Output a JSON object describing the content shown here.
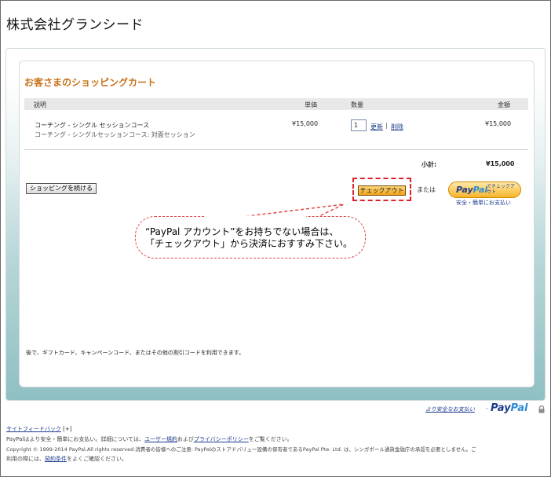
{
  "merchant": {
    "name": "株式会社グランシード"
  },
  "cart": {
    "title": "お客さまのショッピングカート",
    "columns": {
      "description": "説明",
      "unit_price": "単価",
      "quantity": "数量",
      "amount": "金額"
    },
    "items": [
      {
        "name": "コーチング - シングル セッションコース",
        "detail": "コーチング - シングルセッションコース: 対面セッション",
        "unit_price": "¥15,000",
        "quantity": "1",
        "update_label": "更新",
        "separator": "|",
        "remove_label": "削除",
        "amount": "¥15,000"
      }
    ],
    "subtotal_label": "小計:",
    "subtotal_value": "¥15,000",
    "continue_label": "ショッピングを続ける",
    "checkout_label": "チェックアウト",
    "or_label": "または",
    "paypal_button": {
      "logo_pay": "Pay",
      "logo_pal": "Pal",
      "sub_label": "でチェックアウト",
      "note": "安全・簡単にお支払い"
    },
    "gift_note": "後で、ギフトカード、キャンペーンコード、またはその他の割引コードを利用できます。"
  },
  "callout": {
    "line1": "“PayPal アカウント”をお持ちでない場合は、",
    "line2": "「チェックアウト」から決済におすすみ下さい。"
  },
  "secure": {
    "link": "より安全なお支払い",
    "dash": "-",
    "logo_pay": "Pay",
    "logo_pal": "Pal"
  },
  "footer": {
    "sitemap_feedback": "サイトフィードバック",
    "feedback_mark": "[+]",
    "line1_pre": "PayPalはより安全・簡単にお支払い。詳細については、",
    "terms_link": "ユーザー規約",
    "line1_mid": "および",
    "privacy_link": "プライバシーポリシー",
    "line1_post": "をご覧ください。",
    "line2": "Copyright © 1999-2014 PayPal.All rights reserved.消費者の皆様へのご注意: PayPalのストアドバリュー設備の保有者であるPayPal Pte. Ltd. は、シンガポール通貨金融庁の承認を必要としません。ご",
    "line3_pre": "利用の際には、",
    "contract_link": "契約条件",
    "line3_post": "をよくご確認ください。"
  },
  "colors": {
    "title_orange": "#c9721a",
    "highlight_red": "#e0202a",
    "paypal_navy": "#1f3c8c",
    "paypal_blue": "#2b8ad6",
    "link_blue": "#1b3b8f"
  }
}
